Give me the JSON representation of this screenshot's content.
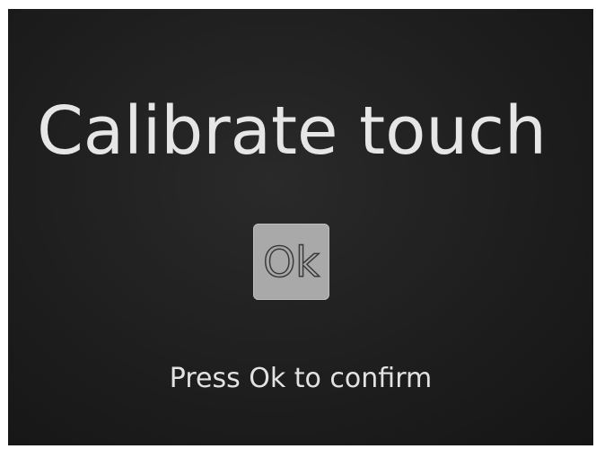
{
  "screen": {
    "title": "Calibrate touch",
    "ok_button_label": "Ok",
    "hint": "Press Ok to confirm"
  },
  "colors": {
    "screen_background": "#1e1e1e",
    "text": "#e6e6e6",
    "button_fill": "#a9a9a9",
    "button_text_outline": "#3a3a3a"
  }
}
